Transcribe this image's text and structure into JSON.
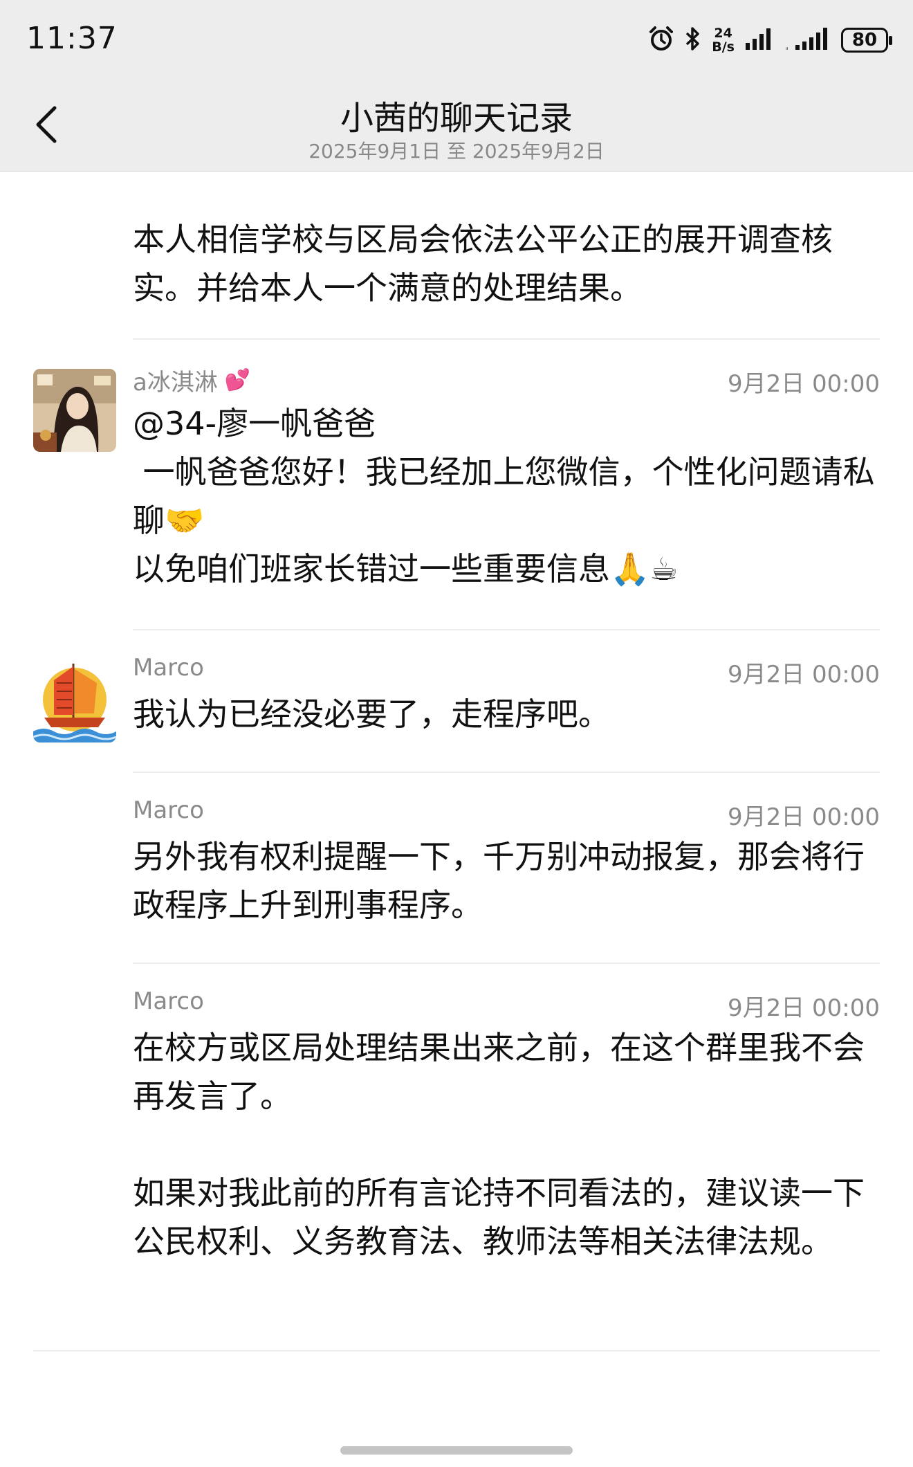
{
  "status_bar": {
    "time": "11:37",
    "net_speed_value": "24",
    "net_speed_unit": "B/s",
    "battery": "80",
    "icons": [
      "alarm-icon",
      "bluetooth-icon",
      "signal-icon",
      "signal-icon"
    ]
  },
  "header": {
    "title": "小茜的聊天记录",
    "subtitle": "2025年9月1日 至 2025年9月2日",
    "back_icon": "chevron-left-icon"
  },
  "messages": [
    {
      "sender": "",
      "time": "",
      "text": "本人相信学校与区局会依法公平公正的展开调查核实。并给本人一个满意的处理结果。"
    },
    {
      "sender": "a冰淇淋",
      "sender_emoji": "💕",
      "time": "9月2日 00:00",
      "text": "@34-廖一帆爸爸\n 一帆爸爸您好！我已经加上您微信，个性化问题请私聊🤝\n以免咱们班家长错过一些重要信息🙏☕"
    },
    {
      "sender": "Marco",
      "time": "9月2日 00:00",
      "text": "我认为已经没必要了，走程序吧。"
    },
    {
      "sender": "Marco",
      "time": "9月2日 00:00",
      "text": "另外我有权利提醒一下，千万别冲动报复，那会将行政程序上升到刑事程序。"
    },
    {
      "sender": "Marco",
      "time": "9月2日 00:00",
      "text": "在校方或区局处理结果出来之前，在这个群里我不会再发言了。\n\n如果对我此前的所有言论持不同看法的，建议读一下公民权利、义务教育法、教师法等相关法律法规。"
    }
  ],
  "colors": {
    "header_bg": "#ededed",
    "meta_text": "#8a8a8a",
    "divider": "#ececec"
  }
}
